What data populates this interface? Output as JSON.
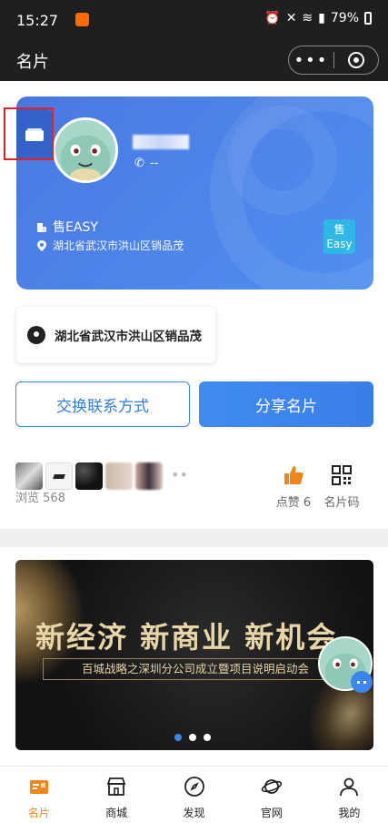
{
  "status_bar": {
    "time": "15:27",
    "battery": "79%"
  },
  "header": {
    "title": "名片",
    "more": "•••"
  },
  "card": {
    "phone": "--",
    "company": "售EASY",
    "address": "湖北省武汉市洪山区销品茂",
    "logo_top": "售",
    "logo_bottom": "Easy"
  },
  "address_pill": {
    "text": "湖北省武汉市洪山区销品茂"
  },
  "buttons": {
    "exchange": "交换联系方式",
    "share": "分享名片"
  },
  "stats": {
    "browse_label": "浏览 568",
    "likes": "点赞 6",
    "qr": "名片码",
    "more_dots": "••"
  },
  "banner": {
    "headline": "新经济 新商业 新机会",
    "subline": "百城战略之深圳分公司成立暨项目说明启动会"
  },
  "tabs": [
    {
      "label": "名片"
    },
    {
      "label": "商城"
    },
    {
      "label": "发现"
    },
    {
      "label": "官网"
    },
    {
      "label": "我的"
    }
  ],
  "colors": {
    "accent": "#f08519",
    "primary": "#3b86ee",
    "card": "#4a7fe5"
  }
}
